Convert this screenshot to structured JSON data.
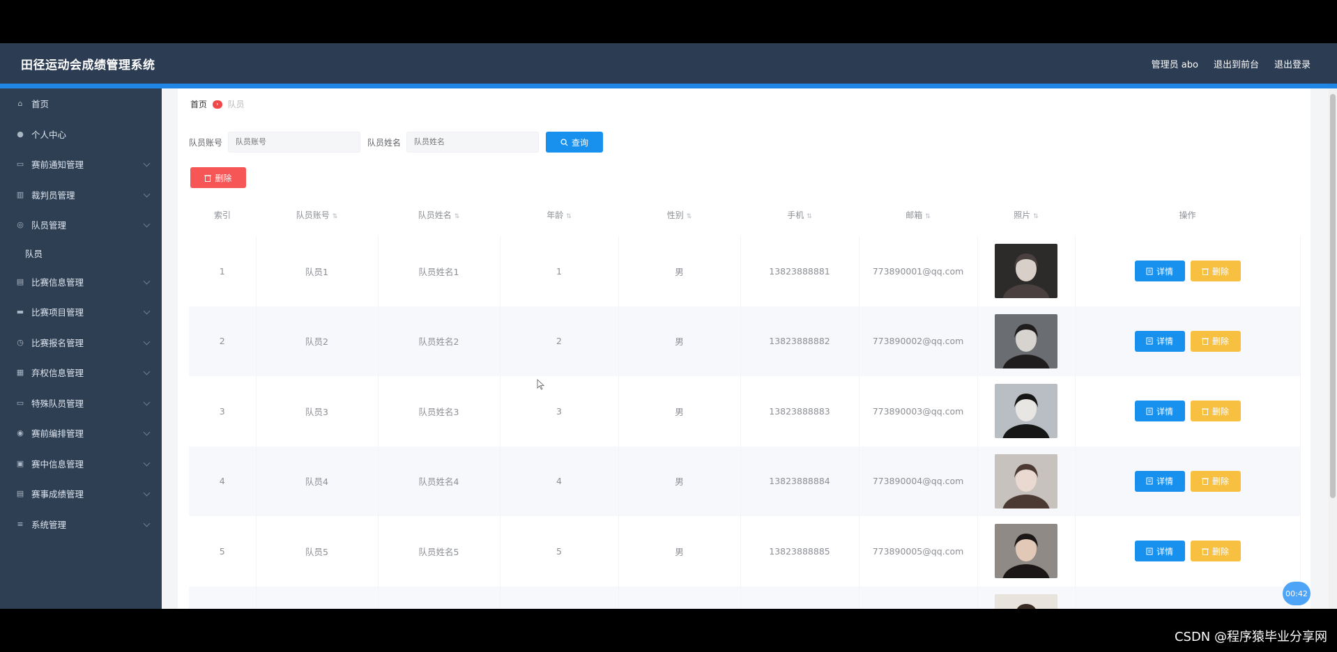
{
  "header": {
    "title": "田径运动会成绩管理系统",
    "user": "管理员 abo",
    "to_front": "退出到前台",
    "logout": "退出登录"
  },
  "sidebar": {
    "items": [
      {
        "label": "首页",
        "icon": "home-icon"
      },
      {
        "label": "个人中心",
        "icon": "user-icon"
      },
      {
        "label": "赛前通知管理",
        "icon": "notice-icon"
      },
      {
        "label": "裁判员管理",
        "icon": "bar-icon"
      },
      {
        "label": "队员管理",
        "icon": "team-icon",
        "expanded": true,
        "sub": [
          {
            "label": "队员"
          }
        ]
      },
      {
        "label": "比赛信息管理",
        "icon": "list-icon"
      },
      {
        "label": "比赛项目管理",
        "icon": "flag-icon"
      },
      {
        "label": "比赛报名管理",
        "icon": "clock-icon"
      },
      {
        "label": "弃权信息管理",
        "icon": "chart-icon"
      },
      {
        "label": "特殊队员管理",
        "icon": "card-icon"
      },
      {
        "label": "赛前编排管理",
        "icon": "check-icon"
      },
      {
        "label": "赛中信息管理",
        "icon": "doc-icon"
      },
      {
        "label": "赛事成绩管理",
        "icon": "score-icon"
      },
      {
        "label": "系统管理",
        "icon": "menu-icon"
      }
    ]
  },
  "breadcrumb": {
    "home": "首页",
    "current": "队员"
  },
  "search": {
    "account_label": "队员账号",
    "name_label": "队员姓名",
    "account_placeholder": "队员账号",
    "name_placeholder": "队员姓名",
    "query_button": "查询"
  },
  "toolbar": {
    "delete_button": "删除"
  },
  "table": {
    "columns": [
      "索引",
      "队员账号",
      "队员姓名",
      "年龄",
      "性别",
      "手机",
      "邮箱",
      "照片",
      "操作"
    ],
    "rows": [
      {
        "index": "1",
        "account": "队员1",
        "name": "队员姓名1",
        "age": "1",
        "gender": "男",
        "phone": "13823888881",
        "email": "773890001@qq.com"
      },
      {
        "index": "2",
        "account": "队员2",
        "name": "队员姓名2",
        "age": "2",
        "gender": "男",
        "phone": "13823888882",
        "email": "773890002@qq.com"
      },
      {
        "index": "3",
        "account": "队员3",
        "name": "队员姓名3",
        "age": "3",
        "gender": "男",
        "phone": "13823888883",
        "email": "773890003@qq.com"
      },
      {
        "index": "4",
        "account": "队员4",
        "name": "队员姓名4",
        "age": "4",
        "gender": "男",
        "phone": "13823888884",
        "email": "773890004@qq.com"
      },
      {
        "index": "5",
        "account": "队员5",
        "name": "队员姓名5",
        "age": "5",
        "gender": "男",
        "phone": "13823888885",
        "email": "773890005@qq.com"
      },
      {
        "index": "",
        "account": "",
        "name": "",
        "age": "",
        "gender": "",
        "phone": "",
        "email": ""
      }
    ],
    "detail_button": "详情",
    "delete_button": "删除"
  },
  "timer": "00:42",
  "watermark": "CSDN @程序猿毕业分享网"
}
